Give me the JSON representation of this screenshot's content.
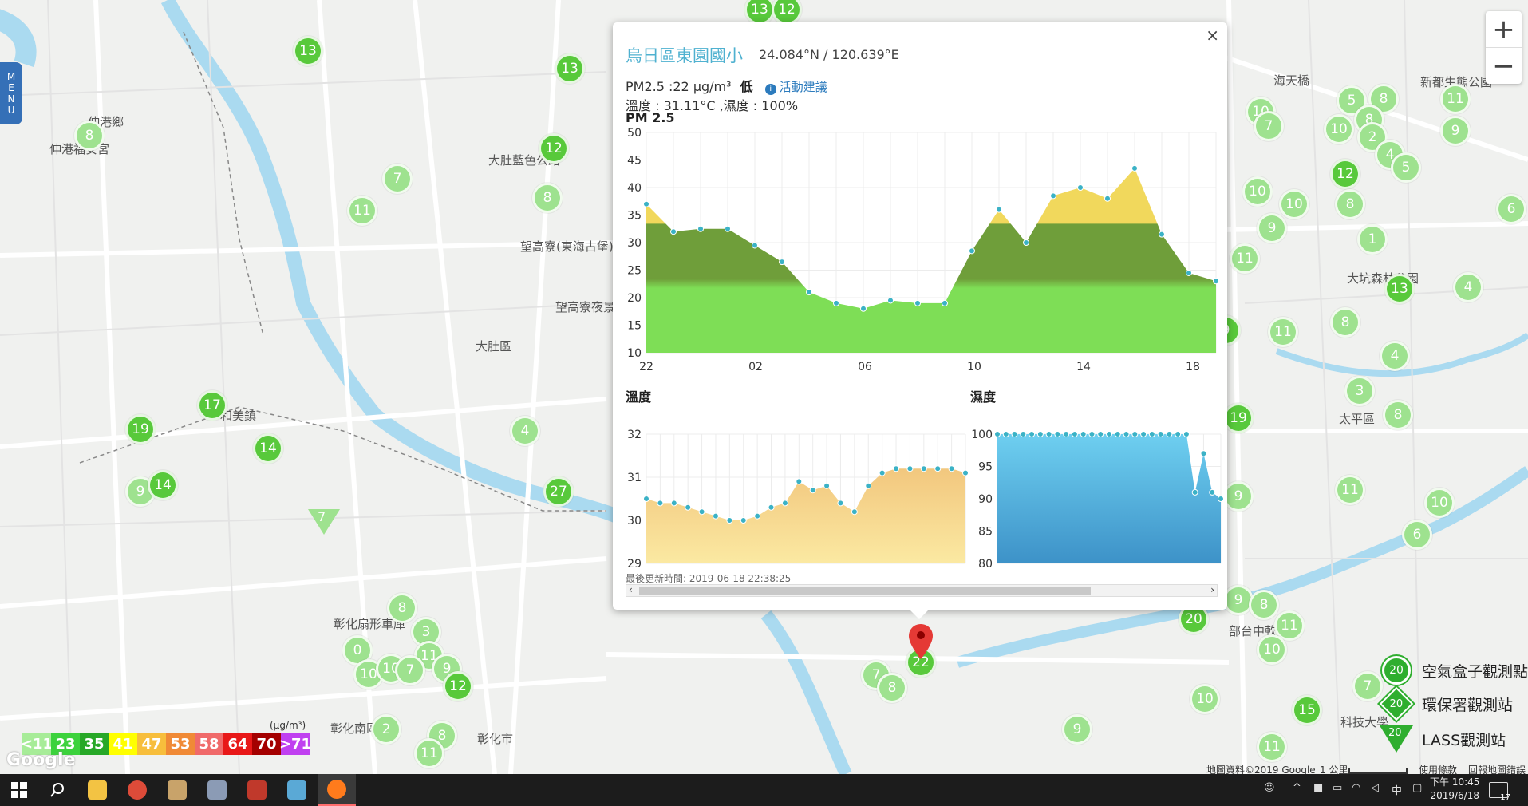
{
  "menu": {
    "label_chars": [
      "M",
      "E",
      "N",
      "U"
    ]
  },
  "zoom": {
    "in": "+",
    "out": "−"
  },
  "place_labels": [
    {
      "text": "伸港鄉",
      "x": 110,
      "y": 142
    },
    {
      "text": "伸港福安宮",
      "x": 62,
      "y": 176
    },
    {
      "text": "大肚藍色公路",
      "x": 612,
      "y": 190
    },
    {
      "text": "望高寮(東海古堡)",
      "x": 652,
      "y": 298
    },
    {
      "text": "望高寮夜景",
      "x": 696,
      "y": 374
    },
    {
      "text": "大肚區",
      "x": 596,
      "y": 423
    },
    {
      "text": "和美鎮",
      "x": 276,
      "y": 510
    },
    {
      "text": "彰化扇形車庫",
      "x": 418,
      "y": 771
    },
    {
      "text": "彰化南區",
      "x": 414,
      "y": 902
    },
    {
      "text": "彰化市",
      "x": 598,
      "y": 915
    },
    {
      "text": "太平區",
      "x": 1678,
      "y": 514
    },
    {
      "text": "海天橋",
      "x": 1596,
      "y": 90
    },
    {
      "text": "新都生態公園",
      "x": 1780,
      "y": 92
    },
    {
      "text": "大坑森林公園",
      "x": 1688,
      "y": 338
    },
    {
      "text": "部台中軟體園",
      "x": 1540,
      "y": 780
    },
    {
      "text": "科技大學",
      "x": 1680,
      "y": 894
    }
  ],
  "markers": [
    {
      "v": "13",
      "x": 386,
      "y": 64,
      "t": "l2"
    },
    {
      "v": "13",
      "x": 714,
      "y": 86,
      "t": "l2"
    },
    {
      "v": "12",
      "x": 694,
      "y": 186,
      "t": "l2"
    },
    {
      "v": "13",
      "x": 952,
      "y": 12,
      "t": "l2"
    },
    {
      "v": "12",
      "x": 986,
      "y": 12,
      "t": "l2"
    },
    {
      "v": "8",
      "x": 112,
      "y": 170,
      "t": "l1"
    },
    {
      "v": "7",
      "x": 498,
      "y": 224,
      "t": "l1"
    },
    {
      "v": "11",
      "x": 454,
      "y": 264,
      "t": "l1"
    },
    {
      "v": "8",
      "x": 686,
      "y": 248,
      "t": "l1"
    },
    {
      "v": "17",
      "x": 266,
      "y": 508,
      "t": "l2"
    },
    {
      "v": "19",
      "x": 176,
      "y": 538,
      "t": "l2"
    },
    {
      "v": "14",
      "x": 336,
      "y": 562,
      "t": "l2"
    },
    {
      "v": "4",
      "x": 658,
      "y": 540,
      "t": "l1"
    },
    {
      "v": "9",
      "x": 176,
      "y": 616,
      "t": "l1"
    },
    {
      "v": "14",
      "x": 204,
      "y": 608,
      "t": "l2"
    },
    {
      "v": "27",
      "x": 700,
      "y": 616,
      "t": "l2"
    },
    {
      "v": "8",
      "x": 504,
      "y": 762,
      "t": "l1"
    },
    {
      "v": "3",
      "x": 534,
      "y": 792,
      "t": "l1"
    },
    {
      "v": "0",
      "x": 448,
      "y": 815,
      "t": "l1"
    },
    {
      "v": "11",
      "x": 538,
      "y": 822,
      "t": "l1"
    },
    {
      "v": "10",
      "x": 462,
      "y": 845,
      "t": "l1"
    },
    {
      "v": "10",
      "x": 490,
      "y": 838,
      "t": "l1"
    },
    {
      "v": "7",
      "x": 514,
      "y": 840,
      "t": "l1"
    },
    {
      "v": "9",
      "x": 560,
      "y": 838,
      "t": "l1"
    },
    {
      "v": "12",
      "x": 574,
      "y": 860,
      "t": "l2"
    },
    {
      "v": "2",
      "x": 484,
      "y": 914,
      "t": "l1"
    },
    {
      "v": "8",
      "x": 554,
      "y": 922,
      "t": "l1"
    },
    {
      "v": "11",
      "x": 538,
      "y": 944,
      "t": "l1"
    },
    {
      "v": "7",
      "x": 1098,
      "y": 846,
      "t": "l1"
    },
    {
      "v": "8",
      "x": 1118,
      "y": 862,
      "t": "l1"
    },
    {
      "v": "22",
      "x": 1154,
      "y": 830,
      "t": "l2"
    },
    {
      "v": "20",
      "x": 1496,
      "y": 776,
      "t": "l2"
    },
    {
      "v": "9",
      "x": 1350,
      "y": 914,
      "t": "l1"
    },
    {
      "v": "5",
      "x": 1694,
      "y": 126,
      "t": "l1"
    },
    {
      "v": "8",
      "x": 1734,
      "y": 124,
      "t": "l1"
    },
    {
      "v": "11",
      "x": 1824,
      "y": 124,
      "t": "l1"
    },
    {
      "v": "10",
      "x": 1580,
      "y": 140,
      "t": "l1"
    },
    {
      "v": "7",
      "x": 1590,
      "y": 158,
      "t": "l1"
    },
    {
      "v": "10",
      "x": 1678,
      "y": 162,
      "t": "l1"
    },
    {
      "v": "8",
      "x": 1716,
      "y": 150,
      "t": "l1"
    },
    {
      "v": "9",
      "x": 1824,
      "y": 164,
      "t": "l1"
    },
    {
      "v": "2",
      "x": 1720,
      "y": 172,
      "t": "l1"
    },
    {
      "v": "4",
      "x": 1742,
      "y": 194,
      "t": "l1"
    },
    {
      "v": "5",
      "x": 1762,
      "y": 210,
      "t": "l1"
    },
    {
      "v": "12",
      "x": 1686,
      "y": 218,
      "t": "l2"
    },
    {
      "v": "10",
      "x": 1576,
      "y": 240,
      "t": "l1"
    },
    {
      "v": "8",
      "x": 1692,
      "y": 256,
      "t": "l1"
    },
    {
      "v": "10",
      "x": 1622,
      "y": 256,
      "t": "l1"
    },
    {
      "v": "6",
      "x": 1894,
      "y": 262,
      "t": "l1"
    },
    {
      "v": "9",
      "x": 1594,
      "y": 286,
      "t": "l1"
    },
    {
      "v": "1",
      "x": 1720,
      "y": 300,
      "t": "l1"
    },
    {
      "v": "11",
      "x": 1560,
      "y": 324,
      "t": "l1"
    },
    {
      "v": "13",
      "x": 1754,
      "y": 362,
      "t": "l2"
    },
    {
      "v": "4",
      "x": 1840,
      "y": 360,
      "t": "l1"
    },
    {
      "v": "8",
      "x": 1686,
      "y": 404,
      "t": "l1"
    },
    {
      "v": "11",
      "x": 1608,
      "y": 416,
      "t": "l1"
    },
    {
      "v": "4",
      "x": 1748,
      "y": 446,
      "t": "l1"
    },
    {
      "v": "3",
      "x": 1704,
      "y": 490,
      "t": "l1"
    },
    {
      "v": "8",
      "x": 1752,
      "y": 520,
      "t": "l1"
    },
    {
      "v": "19",
      "x": 1552,
      "y": 524,
      "t": "l2"
    },
    {
      "v": "11",
      "x": 1692,
      "y": 614,
      "t": "l1"
    },
    {
      "v": "10",
      "x": 1804,
      "y": 630,
      "t": "l1"
    },
    {
      "v": "9",
      "x": 1552,
      "y": 622,
      "t": "l1"
    },
    {
      "v": "6",
      "x": 1776,
      "y": 670,
      "t": "l1"
    },
    {
      "v": "9",
      "x": 1552,
      "y": 752,
      "t": "l1"
    },
    {
      "v": "8",
      "x": 1584,
      "y": 758,
      "t": "l1"
    },
    {
      "v": "11",
      "x": 1616,
      "y": 784,
      "t": "l1"
    },
    {
      "v": "10",
      "x": 1594,
      "y": 814,
      "t": "l1"
    },
    {
      "v": "7",
      "x": 1714,
      "y": 860,
      "t": "l1"
    },
    {
      "v": "10",
      "x": 1510,
      "y": 876,
      "t": "l1"
    },
    {
      "v": "15",
      "x": 1638,
      "y": 890,
      "t": "l2"
    },
    {
      "v": "11",
      "x": 1594,
      "y": 936,
      "t": "l1"
    },
    {
      "v": "9",
      "x": 1536,
      "y": 414,
      "t": "l2"
    }
  ],
  "tri_markers": [
    {
      "v": "7",
      "x": 406,
      "y": 650
    }
  ],
  "popup": {
    "close": "×",
    "title": "烏日區東園國小",
    "coords": "24.084°N / 120.639°E",
    "pm_text": "PM2.5 :22 μg/m³",
    "pm_level": "低",
    "info_glyph": "i",
    "advice": "活動建議",
    "weather": "溫度 : 31.11°C ,濕度 : 100%",
    "pm_chart_title": "PM 2.5",
    "temp_chart_title": "溫度",
    "hum_chart_title": "濕度",
    "updated": "最後更新時間: 2019-06-18 22:38:25",
    "scroll_left": "‹",
    "scroll_right": "›"
  },
  "chart_data": [
    {
      "type": "area",
      "title": "PM 2.5",
      "x_ticks": [
        "22",
        "02",
        "06",
        "10",
        "14",
        "18"
      ],
      "ylim": [
        10,
        50
      ],
      "y_ticks": [
        10,
        15,
        20,
        25,
        30,
        35,
        40,
        45,
        50
      ],
      "values": [
        37,
        32,
        32.5,
        32.5,
        29.5,
        26.5,
        21,
        19,
        18,
        19.5,
        19,
        19,
        28.5,
        36,
        30,
        38.5,
        40,
        38,
        43.5,
        31.5,
        24.5,
        23
      ],
      "grid": true,
      "colors": {
        "low": "#7ede56",
        "mid": "#6f9e3a",
        "high": "#f1d85c"
      }
    },
    {
      "type": "area",
      "title": "溫度",
      "ylim": [
        29,
        32
      ],
      "y_ticks": [
        29,
        30,
        31,
        32
      ],
      "values": [
        30.5,
        30.4,
        30.4,
        30.3,
        30.2,
        30.1,
        30.0,
        30.0,
        30.1,
        30.3,
        30.4,
        30.9,
        30.7,
        30.8,
        30.4,
        30.2,
        30.8,
        31.1,
        31.2,
        31.2,
        31.2,
        31.2,
        31.2,
        31.1
      ],
      "grid": true,
      "colors": {
        "top": "#f2c77e",
        "bottom": "#fbe9a2",
        "line": "#3bb2c6"
      }
    },
    {
      "type": "area",
      "title": "濕度",
      "ylim": [
        80,
        100
      ],
      "y_ticks": [
        80,
        85,
        90,
        95,
        100
      ],
      "values": [
        100,
        100,
        100,
        100,
        100,
        100,
        100,
        100,
        100,
        100,
        100,
        100,
        100,
        100,
        100,
        100,
        100,
        100,
        100,
        100,
        100,
        100,
        100,
        91,
        97,
        91,
        90
      ],
      "grid": true,
      "colors": {
        "top": "#6ecff0",
        "bottom": "#3d92c8",
        "line": "#3bb2c6"
      }
    }
  ],
  "legend_scale": {
    "items": [
      {
        "label": "<11",
        "color": "#a7ec98"
      },
      {
        "label": "23",
        "color": "#3cd23c"
      },
      {
        "label": "35",
        "color": "#27a827"
      },
      {
        "label": "41",
        "color": "#ffff00"
      },
      {
        "label": "47",
        "color": "#f7be3c"
      },
      {
        "label": "53",
        "color": "#f08a36"
      },
      {
        "label": "58",
        "color": "#f06a6a"
      },
      {
        "label": "64",
        "color": "#e81818"
      },
      {
        "label": "70",
        "color": "#a40000"
      },
      {
        "label": ">71",
        "color": "#c040f0"
      }
    ],
    "unit": "(μg/m³)"
  },
  "station_legend": {
    "airbox": {
      "label": "空氣盒子觀測點",
      "value": "20"
    },
    "epa": {
      "label": "環保署觀測站",
      "value": "20"
    },
    "lass": {
      "label": "LASS觀測站",
      "value": "20"
    }
  },
  "attribution": {
    "google": "Google",
    "map_data": "地圖資料©2019 Google",
    "scale": "1 公里",
    "terms": "使用條款",
    "report": "回報地圖錯誤"
  },
  "taskbar": {
    "time": "下午 10:45",
    "date": "2019/6/18",
    "ime": "中",
    "notifications": "17"
  }
}
